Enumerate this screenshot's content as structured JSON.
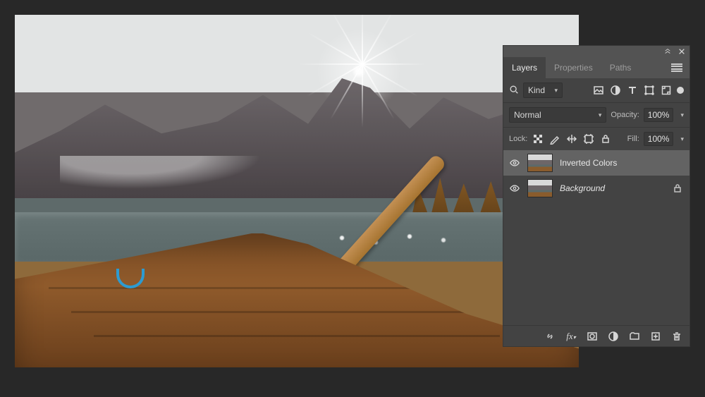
{
  "panel": {
    "tabs": [
      "Layers",
      "Properties",
      "Paths"
    ],
    "active_tab": 0,
    "filter": {
      "label": "Kind"
    },
    "blend": {
      "mode": "Normal",
      "opacity_label": "Opacity:",
      "opacity_value": "100%"
    },
    "lock": {
      "label": "Lock:",
      "fill_label": "Fill:",
      "fill_value": "100%"
    },
    "layers": [
      {
        "name": "Inverted Colors",
        "visible": true,
        "active": true,
        "locked": false
      },
      {
        "name": "Background",
        "visible": true,
        "active": false,
        "locked": true
      }
    ]
  },
  "icons": {
    "filter_row": [
      "image-icon",
      "adjustment-icon",
      "type-icon",
      "shape-icon",
      "smart-object-icon"
    ],
    "lock_row": [
      "lock-transparent-icon",
      "lock-pixels-icon",
      "lock-position-icon",
      "lock-artboard-icon",
      "lock-all-icon"
    ],
    "footer": [
      "link-layers-icon",
      "layer-style-icon",
      "layer-mask-icon",
      "adjustment-layer-icon",
      "group-icon",
      "new-layer-icon",
      "delete-layer-icon"
    ]
  },
  "colors": {
    "panel_bg": "#535353",
    "panel_body": "#434343",
    "row_active": "#636363",
    "canvas_bg": "#282828"
  }
}
